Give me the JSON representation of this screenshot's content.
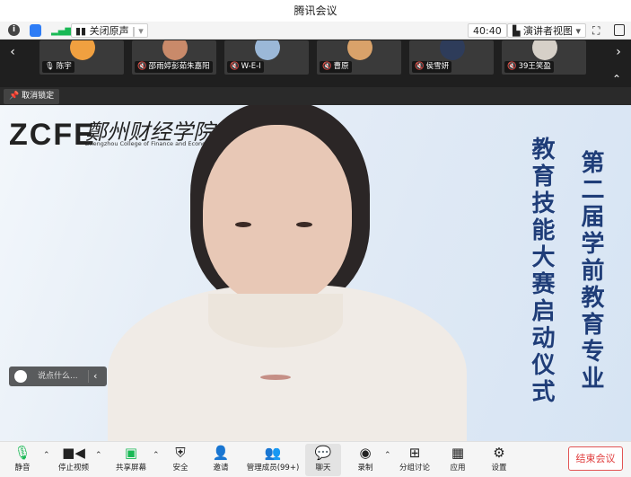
{
  "window": {
    "title": "腾讯会议"
  },
  "toolbar": {
    "mute_original_label": "关闭原声",
    "timer": "40:40",
    "view_mode_label": "演讲者视图"
  },
  "participants": [
    {
      "name": "陈宇",
      "color": "#f0a040",
      "mic": "on"
    },
    {
      "name": "邵雨婷彭茹朱嘉阳",
      "color": "#c98a6a",
      "mic": "muted"
    },
    {
      "name": "W-E-I",
      "color": "#9bb8d8",
      "mic": "muted"
    },
    {
      "name": "曹原",
      "color": "#d9a26a",
      "mic": "muted"
    },
    {
      "name": "侯雪妍",
      "color": "#2e3c5a",
      "mic": "muted"
    },
    {
      "name": "39王笑盈",
      "color": "#d6d0c8",
      "mic": "muted"
    }
  ],
  "stage": {
    "unpin_label": "取消锁定",
    "logo_text": "ZCFE",
    "logo_cn": "鄭州财经学院",
    "logo_en": "Zhengzhou College of Finance and Economics",
    "banner_col1": "第二届学前教育专业",
    "banner_col2": "教育技能大赛启动仪式",
    "chat_placeholder": "说点什么..."
  },
  "bottom": {
    "mute": "静音",
    "stop_video": "停止视频",
    "share_screen": "共享屏幕",
    "security": "安全",
    "invite": "邀请",
    "manage_members": "管理成员(99+)",
    "chat": "聊天",
    "record": "录制",
    "breakout": "分组讨论",
    "apps": "应用",
    "settings": "设置",
    "end_meeting": "结束会议"
  },
  "colors": {
    "accent_green": "#19b955",
    "end_red": "#e03c3c",
    "banner_blue": "#1f3d78"
  }
}
